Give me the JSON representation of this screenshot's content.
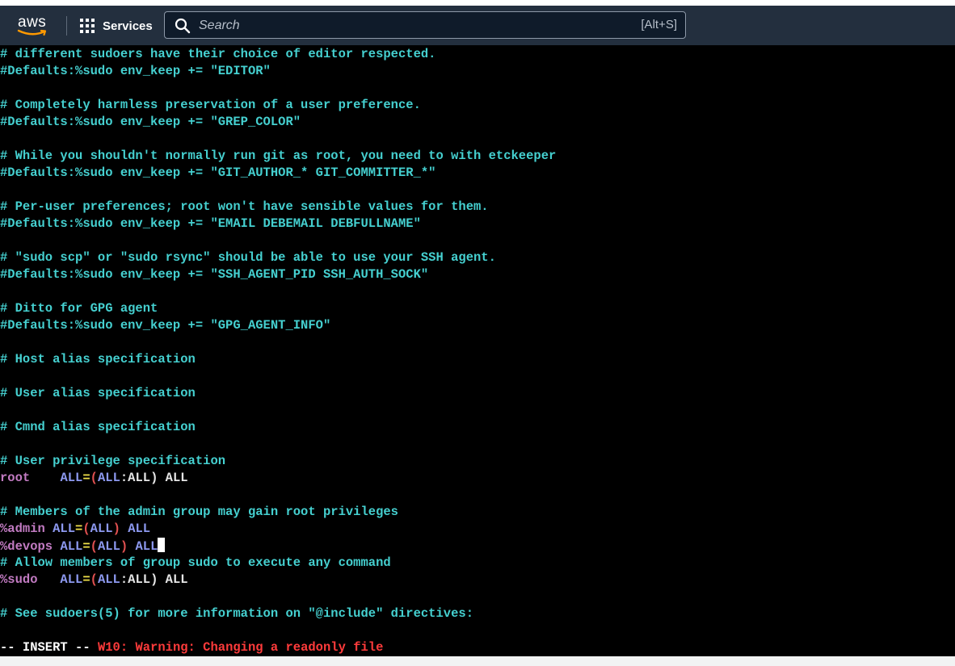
{
  "navbar": {
    "logo_text": "aws",
    "services_label": "Services",
    "search_placeholder": "Search",
    "search_value": "",
    "search_shortcut": "[Alt+S]",
    "colors": {
      "navbar_bg": "#232f3e",
      "search_bg": "#0f1b2a",
      "aws_smile": "#ff9900"
    }
  },
  "terminal": {
    "lines": [
      {
        "segments": [
          {
            "cls": "c-comment",
            "text": "# different sudoers have their choice of editor respected."
          }
        ]
      },
      {
        "segments": [
          {
            "cls": "c-defaults",
            "text": "#Defaults:%sudo env_keep += \"EDITOR\""
          }
        ]
      },
      {
        "segments": []
      },
      {
        "segments": [
          {
            "cls": "c-comment",
            "text": "# Completely harmless preservation of a user preference."
          }
        ]
      },
      {
        "segments": [
          {
            "cls": "c-defaults",
            "text": "#Defaults:%sudo env_keep += \"GREP_COLOR\""
          }
        ]
      },
      {
        "segments": []
      },
      {
        "segments": [
          {
            "cls": "c-comment",
            "text": "# While you shouldn't normally run git as root, you need to with etckeeper"
          }
        ]
      },
      {
        "segments": [
          {
            "cls": "c-defaults",
            "text": "#Defaults:%sudo env_keep += \"GIT_AUTHOR_* GIT_COMMITTER_*\""
          }
        ]
      },
      {
        "segments": []
      },
      {
        "segments": [
          {
            "cls": "c-comment",
            "text": "# Per-user preferences; root won't have sensible values for them."
          }
        ]
      },
      {
        "segments": [
          {
            "cls": "c-defaults",
            "text": "#Defaults:%sudo env_keep += \"EMAIL DEBEMAIL DEBFULLNAME\""
          }
        ]
      },
      {
        "segments": []
      },
      {
        "segments": [
          {
            "cls": "c-comment",
            "text": "# \"sudo scp\" or \"sudo rsync\" should be able to use your SSH agent."
          }
        ]
      },
      {
        "segments": [
          {
            "cls": "c-defaults",
            "text": "#Defaults:%sudo env_keep += \"SSH_AGENT_PID SSH_AUTH_SOCK\""
          }
        ]
      },
      {
        "segments": []
      },
      {
        "segments": [
          {
            "cls": "c-comment",
            "text": "# Ditto for GPG agent"
          }
        ]
      },
      {
        "segments": [
          {
            "cls": "c-defaults",
            "text": "#Defaults:%sudo env_keep += \"GPG_AGENT_INFO\""
          }
        ]
      },
      {
        "segments": []
      },
      {
        "segments": [
          {
            "cls": "c-comment",
            "text": "# Host alias specification"
          }
        ]
      },
      {
        "segments": []
      },
      {
        "segments": [
          {
            "cls": "c-comment",
            "text": "# User alias specification"
          }
        ]
      },
      {
        "segments": []
      },
      {
        "segments": [
          {
            "cls": "c-comment",
            "text": "# Cmnd alias specification"
          }
        ]
      },
      {
        "segments": []
      },
      {
        "segments": [
          {
            "cls": "c-comment",
            "text": "# User privilege specification"
          }
        ]
      },
      {
        "segments": [
          {
            "cls": "c-user",
            "text": "root"
          },
          {
            "cls": "c-plain",
            "text": "    "
          },
          {
            "cls": "c-keyword",
            "text": "ALL"
          },
          {
            "cls": "c-op",
            "text": "="
          },
          {
            "cls": "c-paren",
            "text": "("
          },
          {
            "cls": "c-keyword",
            "text": "ALL"
          },
          {
            "cls": "c-plain",
            "text": ":ALL) ALL"
          }
        ]
      },
      {
        "segments": []
      },
      {
        "segments": [
          {
            "cls": "c-comment",
            "text": "# Members of the admin group may gain root privileges"
          }
        ]
      },
      {
        "segments": [
          {
            "cls": "c-user",
            "text": "%admin"
          },
          {
            "cls": "c-plain",
            "text": " "
          },
          {
            "cls": "c-keyword",
            "text": "ALL"
          },
          {
            "cls": "c-op",
            "text": "="
          },
          {
            "cls": "c-paren",
            "text": "("
          },
          {
            "cls": "c-keyword",
            "text": "ALL"
          },
          {
            "cls": "c-paren",
            "text": ")"
          },
          {
            "cls": "c-plain",
            "text": " "
          },
          {
            "cls": "c-keyword",
            "text": "ALL"
          }
        ]
      },
      {
        "segments": [
          {
            "cls": "c-user",
            "text": "%devops"
          },
          {
            "cls": "c-plain",
            "text": " "
          },
          {
            "cls": "c-keyword",
            "text": "ALL"
          },
          {
            "cls": "c-op",
            "text": "="
          },
          {
            "cls": "c-paren",
            "text": "("
          },
          {
            "cls": "c-keyword",
            "text": "ALL"
          },
          {
            "cls": "c-paren",
            "text": ")"
          },
          {
            "cls": "c-plain",
            "text": " "
          },
          {
            "cls": "c-keyword",
            "text": "ALL"
          }
        ],
        "cursor": true
      },
      {
        "segments": [
          {
            "cls": "c-comment",
            "text": "# Allow members of group sudo to execute any command"
          }
        ]
      },
      {
        "segments": [
          {
            "cls": "c-user",
            "text": "%sudo"
          },
          {
            "cls": "c-plain",
            "text": "   "
          },
          {
            "cls": "c-keyword",
            "text": "ALL"
          },
          {
            "cls": "c-op",
            "text": "="
          },
          {
            "cls": "c-paren",
            "text": "("
          },
          {
            "cls": "c-keyword",
            "text": "ALL"
          },
          {
            "cls": "c-plain",
            "text": ":ALL) ALL"
          }
        ]
      },
      {
        "segments": []
      },
      {
        "segments": [
          {
            "cls": "c-comment",
            "text": "# See sudoers(5) for more information on \"@include\" directives:"
          }
        ]
      },
      {
        "segments": []
      }
    ],
    "status": {
      "mode": "-- INSERT --",
      "warning": "W10: Warning: Changing a readonly file"
    }
  }
}
